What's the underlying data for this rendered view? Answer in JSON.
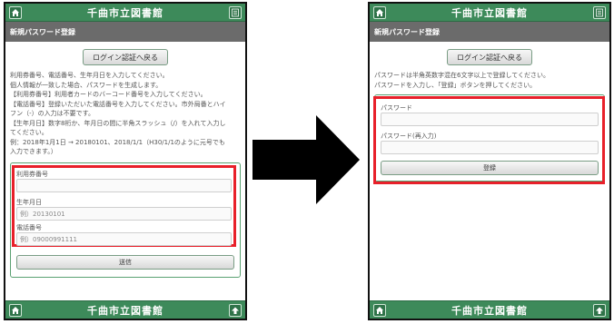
{
  "app": {
    "title": "千曲市立図書館"
  },
  "left": {
    "subheader": "新規パスワード登録",
    "back_button": "ログイン認証へ戻る",
    "instructions": [
      "利用券番号、電話番号、生年月日を入力してください。",
      "個人情報が一致した場合、パスワードを生成します。",
      "【利用券番号】利用者カードのバーコード番号を入力してください。",
      "【電話番号】登録いただいた電話番号を入力してください。市外局番とハイ",
      "フン（-）の入力は不要です。",
      "【生年月日】数字8桁か、年月日の間に半角スラッシュ（/）を入れて入力し",
      "てください。",
      "例：2018年1月1日 → 20180101、2018/1/1（H30/1/1のように元号でも",
      "入力できます。）"
    ],
    "fields": {
      "card": {
        "label": "利用券番号",
        "placeholder": ""
      },
      "birth": {
        "label": "生年月日",
        "placeholder": "例）20130101"
      },
      "phone": {
        "label": "電話番号",
        "placeholder": "例）09000991111"
      }
    },
    "submit": "送信"
  },
  "right": {
    "subheader": "新規パスワード登録",
    "back_button": "ログイン認証へ戻る",
    "instructions": [
      "パスワードは半角英数字混在6文字以上で登録してください。",
      "パスワードを入力し、「登録」ボタンを押してください。"
    ],
    "fields": {
      "password": {
        "label": "パスワード",
        "placeholder": ""
      },
      "password_confirm": {
        "label": "パスワード(再入力)",
        "placeholder": ""
      }
    },
    "submit": "登録"
  },
  "colors": {
    "header": "#3d8a5a",
    "subheader": "#6b6b6b",
    "highlight": "#e8202a"
  },
  "icons": {
    "home": "home-icon",
    "menu": "menu-icon",
    "top": "page-top-icon",
    "arrow": "right-arrow-icon"
  }
}
